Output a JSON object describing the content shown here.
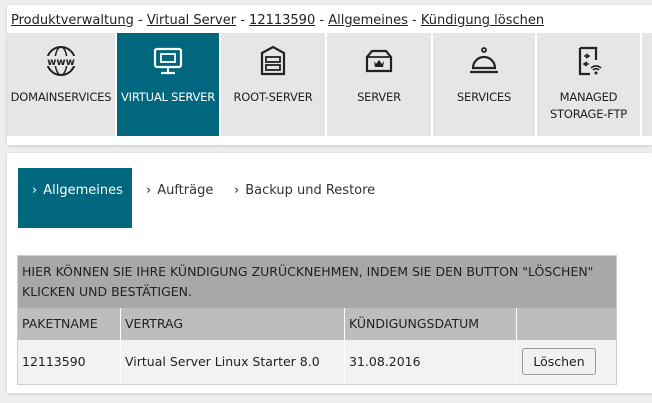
{
  "breadcrumb": [
    {
      "label": "Produktverwaltung"
    },
    {
      "label": "Virtual Server"
    },
    {
      "label": "12113590"
    },
    {
      "label": "Allgemeines"
    },
    {
      "label": "Kündigung löschen"
    }
  ],
  "breadcrumb_separator": "-",
  "tiles": [
    {
      "label": "DOMAINSERVICES",
      "icon": "www-globe-icon"
    },
    {
      "label": "VIRTUAL SERVER",
      "icon": "monitor-icon",
      "active": true
    },
    {
      "label": "ROOT-SERVER",
      "icon": "server-box-icon"
    },
    {
      "label": "SERVER",
      "icon": "server-crown-icon"
    },
    {
      "label": "SERVICES",
      "icon": "service-bell-icon"
    },
    {
      "label": "MANAGED\nSTORAGE-FTP",
      "icon": "storage-ftp-icon"
    }
  ],
  "tabs": [
    {
      "label": "Allgemeines",
      "active": true
    },
    {
      "label": "Aufträge"
    },
    {
      "label": "Backup und Restore"
    }
  ],
  "notice": "Hier können Sie Ihre Kündigung zurücknehmen, indem Sie den Button \"Löschen\" klicken und bestätigen.",
  "table": {
    "headers": [
      "PAKETNAME",
      "VERTRAG",
      "KÜNDIGUNGSDATUM",
      ""
    ],
    "rows": [
      {
        "paketname": "12113590",
        "vertrag": "Virtual Server Linux Starter 8.0",
        "datum": "31.08.2016",
        "action": "Löschen"
      }
    ]
  },
  "colors": {
    "accent": "#00677f",
    "tile_bg": "#e6e6e6",
    "notice_bg": "#a8a8a8",
    "header_bg": "#bdbdbd"
  }
}
